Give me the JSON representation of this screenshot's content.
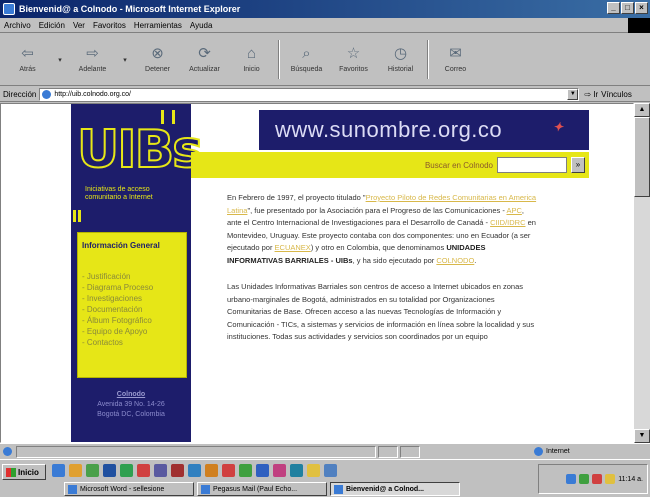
{
  "window": {
    "title": "Bienvenid@ a Colnodo - Microsoft Internet Explorer",
    "controls": [
      "_",
      "□",
      "×"
    ]
  },
  "menu": [
    "Archivo",
    "Edición",
    "Ver",
    "Favoritos",
    "Herramientas",
    "Ayuda"
  ],
  "toolbar": {
    "back": "Atrás",
    "forward": "Adelante",
    "stop": "Detener",
    "refresh": "Actualizar",
    "home": "Inicio",
    "search": "Búsqueda",
    "favorites": "Favoritos",
    "history": "Historial",
    "mail": "Correo"
  },
  "address": {
    "label": "Dirección",
    "url": "http://uib.colnodo.org.co/",
    "go": "Ir",
    "links": "Vínculos"
  },
  "page": {
    "logo_text": "UIBs",
    "logo_tagline": "Iniciativas de acceso comunitario a Internet",
    "banner_text": "www.sunombre.org.co",
    "search_label": "Buscar en Colnodo",
    "search_button": "»",
    "menu_heading": "Información General",
    "menu_items": [
      "- Justificación",
      "- Diagrama Proceso",
      "- Investigaciones",
      "- Documentación",
      "- Álbum Fotográfico",
      "- Equipo de Apoyo",
      "- Contactos"
    ],
    "contact": {
      "title": "Colnodo",
      "address1": "Avenida 39 No. 14-26",
      "address2": "Bogotá DC, Colombia"
    },
    "para1": {
      "t1": "En Febrero de 1997, el proyecto titulado \"",
      "l1": "Proyecto Piloto de Redes Comunitarias en America Latina",
      "t2": "\", fue presentado por la Asociación para el Progreso de las Comunicaciones - ",
      "l2": "APC",
      "t3": ", ante el Centro Internacional de Investigaciones para el Desarrollo de Canadá - ",
      "l3": "CIID/IDRC",
      "t4": " en Montevideo, Uruguay. Este proyecto contaba con dos componentes: uno en Ecuador (a ser ejecutado por ",
      "l4": "ECUANEX",
      "t5": ") y otro en Colombia, que denominamos ",
      "b1": "UNIDADES INFORMATIVAS BARRIALES - UIBs",
      "t6": ", y ha sido ejecutado por ",
      "l5": "COLNODO",
      "t7": "."
    },
    "para2": "Las Unidades Informativas Barriales son centros de acceso a Internet ubicados en zonas urbano-marginales de Bogotá, administrados en su totalidad por Organizaciones Comunitarias de Base. Ofrecen acceso a las nuevas Tecnologías de Información y Comunicación - TICs, a sistemas y servicios de información en línea sobre la localidad y sus instituciones. Todas sus actividades y servicios son coordinados por un equipo"
  },
  "status": {
    "zone": "Internet"
  },
  "taskbar": {
    "start": "Inicio",
    "tasks": [
      "Microsoft Word - sellesione",
      "Pegasus Mail (Paul Echo...",
      "Bienvenid@ a Colnod..."
    ],
    "clock": "11:14 a."
  }
}
